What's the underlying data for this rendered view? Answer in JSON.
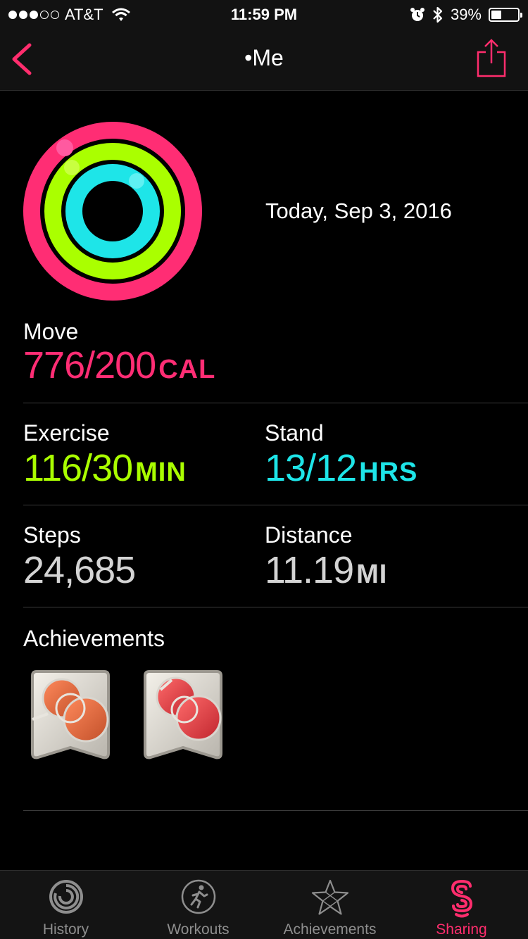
{
  "status_bar": {
    "carrier": "AT&T",
    "time": "11:59 PM",
    "battery": "39%",
    "battery_level": 0.39,
    "signal_bars_filled": 3,
    "signal_bars_total": 5
  },
  "nav": {
    "title": "•Me",
    "back_icon": "chevron-left-icon",
    "share_icon": "share-icon"
  },
  "summary": {
    "date": "Today, Sep 3, 2016",
    "rings": {
      "move_progress": 3.88,
      "exercise_progress": 3.87,
      "stand_progress": 1.083
    }
  },
  "move": {
    "label": "Move",
    "value": "776/200",
    "unit": "CAL"
  },
  "exercise": {
    "label": "Exercise",
    "value": "116/30",
    "unit": "MIN"
  },
  "stand": {
    "label": "Stand",
    "value": "13/12",
    "unit": "HRS"
  },
  "steps": {
    "label": "Steps",
    "value": "24,685"
  },
  "distance": {
    "label": "Distance",
    "value": "11.19",
    "unit": "MI"
  },
  "achievements": {
    "title": "Achievements"
  },
  "colors": {
    "move": "#ff2d74",
    "exercise": "#aaff00",
    "stand": "#1ee5e8",
    "muted": "#d4d4d4",
    "tab_active": "#ff2d6d",
    "tab_inactive": "#8e8e8e"
  },
  "tabs": [
    {
      "label": "History",
      "icon": "history-icon",
      "active": false
    },
    {
      "label": "Workouts",
      "icon": "workouts-icon",
      "active": false
    },
    {
      "label": "Achievements",
      "icon": "achievements-icon",
      "active": false
    },
    {
      "label": "Sharing",
      "icon": "sharing-icon",
      "active": true
    }
  ]
}
